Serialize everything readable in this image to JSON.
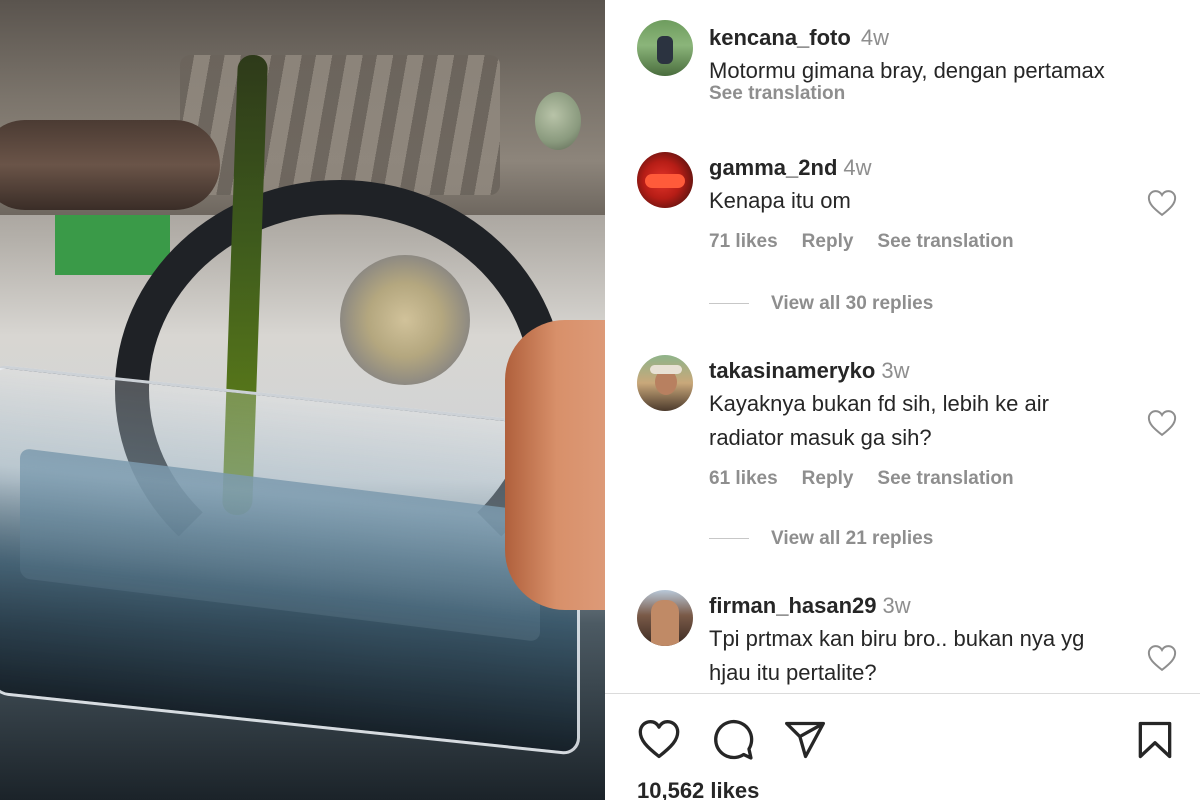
{
  "media": {
    "description_icon": "video-frame-icon"
  },
  "comments": [
    {
      "username": "kencana_foto",
      "time": "4w",
      "text": "Motormu gimana bray, dengan pertamax",
      "see_translation": "See translation"
    },
    {
      "username": "gamma_2nd",
      "time": "4w",
      "text": "Kenapa itu om",
      "likes": "71 likes",
      "reply": "Reply",
      "see_translation": "See translation",
      "view_replies": "View all 30 replies"
    },
    {
      "username": "takasinameryko",
      "time": "3w",
      "text_line1": "Kayaknya bukan fd sih, lebih ke air",
      "text_line2": "radiator masuk ga sih?",
      "likes": "61 likes",
      "reply": "Reply",
      "see_translation": "See translation",
      "view_replies": "View all 21 replies"
    },
    {
      "username": "firman_hasan29",
      "time": "3w",
      "text_line1": "Tpi prtmax kan biru bro.. bukan nya yg",
      "text_line2": "hjau itu pertalite?"
    }
  ],
  "actions": {
    "like_icon": "heart-icon",
    "comment_icon": "comment-icon",
    "share_icon": "send-icon",
    "save_icon": "bookmark-icon"
  },
  "post": {
    "likes": "10,562 likes"
  },
  "colors": {
    "text": "#262626",
    "secondary": "#8e8e8e",
    "divider": "#dbdbdb"
  }
}
